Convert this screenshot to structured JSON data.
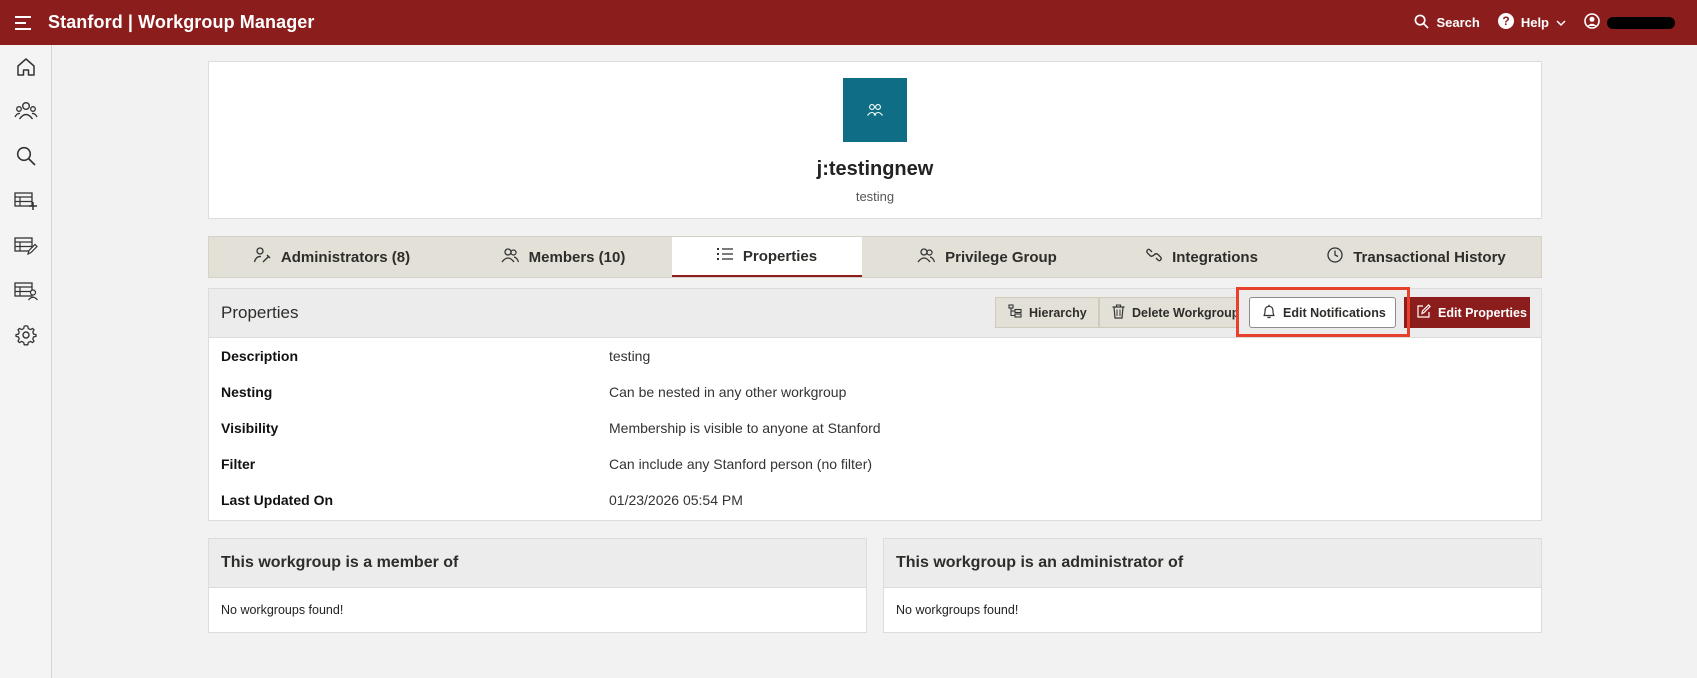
{
  "app": {
    "title": "Stanford | Workgroup Manager"
  },
  "topbar": {
    "search_label": "Search",
    "help_label": "Help"
  },
  "sidebar": {
    "items": [
      {
        "icon": "home-icon"
      },
      {
        "icon": "workgroups-icon"
      },
      {
        "icon": "search-icon"
      },
      {
        "icon": "add-workgroup-icon"
      },
      {
        "icon": "edit-workgroup-icon"
      },
      {
        "icon": "workgroup-members-icon"
      },
      {
        "icon": "gear-icon"
      }
    ]
  },
  "group": {
    "name": "j:testingnew",
    "subtitle": "testing"
  },
  "tabs": [
    {
      "label": "Administrators (8)",
      "icon": "admin-icon"
    },
    {
      "label": "Members (10)",
      "icon": "members-icon"
    },
    {
      "label": "Properties",
      "icon": "list-icon",
      "active": true
    },
    {
      "label": "Privilege Group",
      "icon": "privilege-icon"
    },
    {
      "label": "Integrations",
      "icon": "link-icon"
    },
    {
      "label": "Transactional History",
      "icon": "clock-icon"
    }
  ],
  "properties": {
    "title": "Properties",
    "buttons": {
      "hierarchy": "Hierarchy",
      "delete": "Delete Workgroup",
      "notifications": "Edit Notifications",
      "edit": "Edit Properties"
    },
    "rows": [
      {
        "label": "Description",
        "value": "testing"
      },
      {
        "label": "Nesting",
        "value": "Can be nested in any other workgroup"
      },
      {
        "label": "Visibility",
        "value": "Membership is visible to anyone at Stanford"
      },
      {
        "label": "Filter",
        "value": "Can include any Stanford person (no filter)"
      },
      {
        "label": "Last Updated On",
        "value": "01/23/2026 05:54 PM"
      }
    ]
  },
  "member_of": {
    "title": "This workgroup is a member of",
    "empty": "No workgroups found!"
  },
  "admin_of": {
    "title": "This workgroup is an administrator of",
    "empty": "No workgroups found!"
  },
  "colors": {
    "brand": "#8c1d1d",
    "avatar": "#0f6e85",
    "highlight": "#e8412b"
  }
}
